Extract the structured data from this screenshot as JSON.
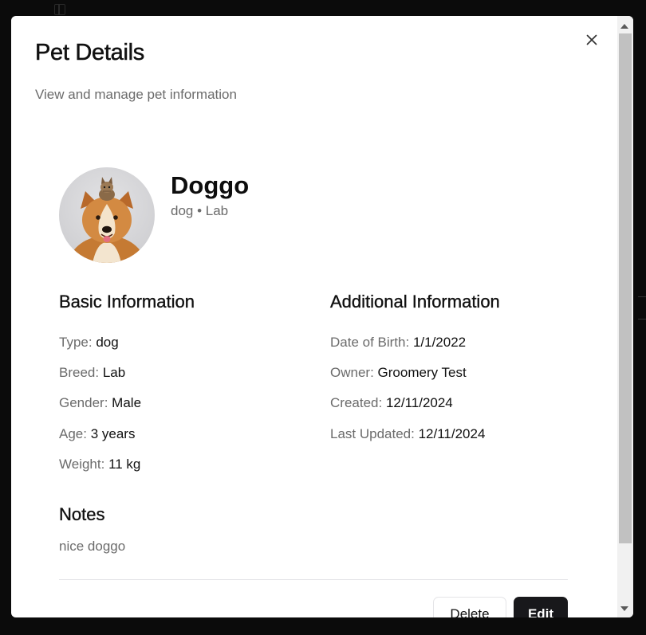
{
  "dialog": {
    "title": "Pet Details",
    "subtitle": "View and manage pet information",
    "close_icon": "close-icon"
  },
  "pet": {
    "name": "Doggo",
    "subtitle": "dog • Lab",
    "avatar": "pet-photo-dog-with-kitten"
  },
  "basic_info": {
    "title": "Basic Information",
    "rows": [
      {
        "label": "Type:",
        "value": "dog"
      },
      {
        "label": "Breed:",
        "value": "Lab"
      },
      {
        "label": "Gender:",
        "value": "Male"
      },
      {
        "label": "Age:",
        "value": "3 years"
      },
      {
        "label": "Weight:",
        "value": "11 kg"
      }
    ]
  },
  "additional_info": {
    "title": "Additional Information",
    "rows": [
      {
        "label": "Date of Birth:",
        "value": "1/1/2022"
      },
      {
        "label": "Owner:",
        "value": "Groomery Test"
      },
      {
        "label": "Created:",
        "value": "12/11/2024"
      },
      {
        "label": "Last Updated:",
        "value": "12/11/2024"
      }
    ]
  },
  "notes": {
    "title": "Notes",
    "text": "nice doggo"
  },
  "actions": {
    "delete_label": "Delete",
    "edit_label": "Edit"
  },
  "colors": {
    "primary_button": "#18181b",
    "muted_text": "#6b6b6b",
    "backdrop": "#0b0b0b"
  }
}
